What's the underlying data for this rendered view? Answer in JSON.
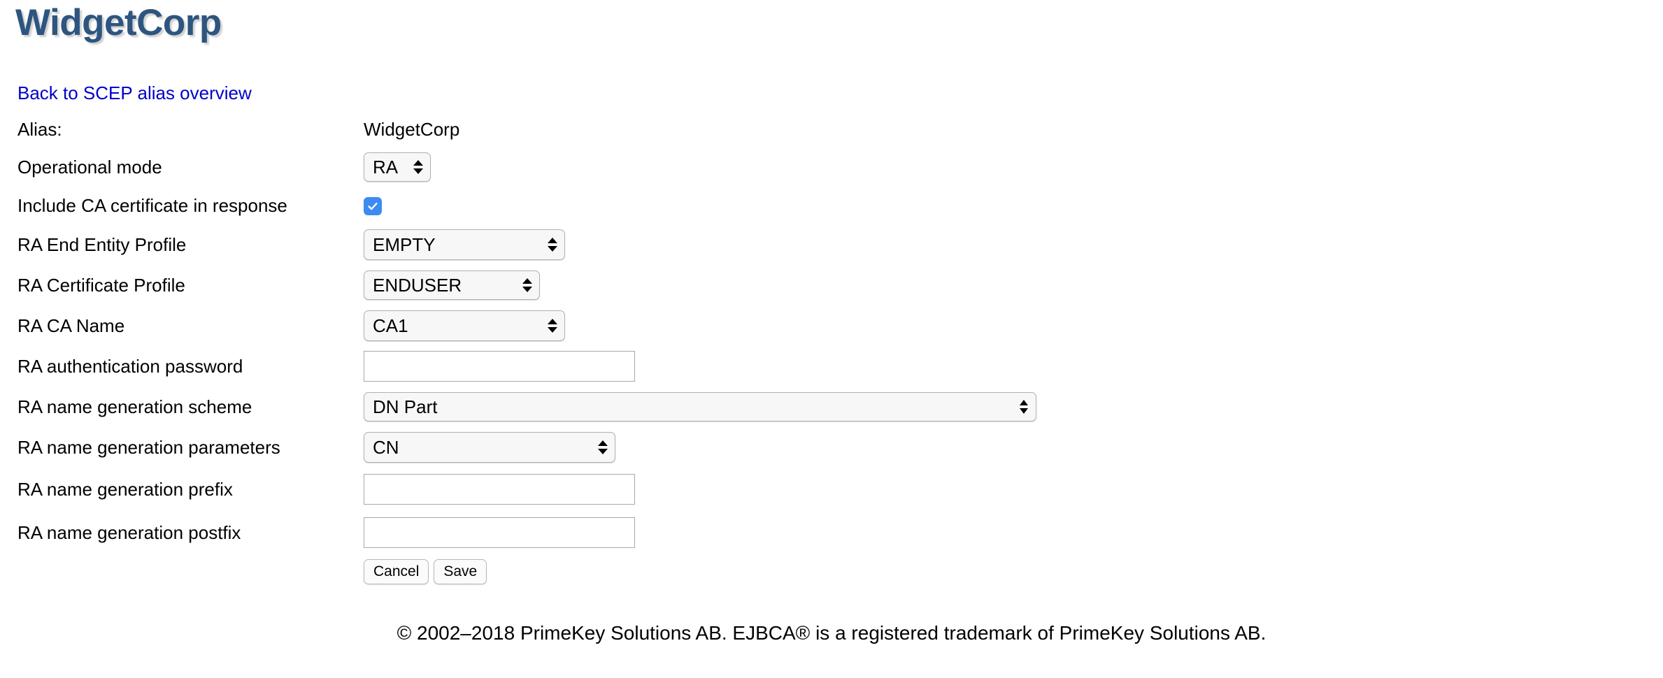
{
  "header": {
    "app_title": "WidgetCorp",
    "title_color": "#2d5580"
  },
  "nav": {
    "back_link": "Back to SCEP alias overview",
    "link_color": "#0000cc"
  },
  "form": {
    "alias": {
      "label": "Alias:",
      "value": "WidgetCorp"
    },
    "operational_mode": {
      "label": "Operational mode",
      "value": "RA"
    },
    "include_ca_cert": {
      "label": "Include CA certificate in response",
      "checked": true,
      "checkbox_color": "#3d8bf2"
    },
    "ra_end_entity_profile": {
      "label": "RA End Entity Profile",
      "value": "EMPTY"
    },
    "ra_certificate_profile": {
      "label": "RA Certificate Profile",
      "value": "ENDUSER"
    },
    "ra_ca_name": {
      "label": "RA CA Name",
      "value": "CA1"
    },
    "ra_auth_password": {
      "label": "RA authentication password",
      "value": "",
      "placeholder": ""
    },
    "ra_name_generation_scheme": {
      "label": "RA name generation scheme",
      "value": "DN Part"
    },
    "ra_name_generation_parameters": {
      "label": "RA name generation parameters",
      "value": "CN"
    },
    "ra_name_generation_prefix": {
      "label": "RA name generation prefix",
      "value": "",
      "placeholder": ""
    },
    "ra_name_generation_postfix": {
      "label": "RA name generation postfix",
      "value": "",
      "placeholder": ""
    }
  },
  "actions": {
    "cancel_label": "Cancel",
    "save_label": "Save"
  },
  "footer": {
    "copyright": "© 2002–2018 PrimeKey Solutions AB. EJBCA® is a registered trademark of PrimeKey Solutions AB."
  }
}
